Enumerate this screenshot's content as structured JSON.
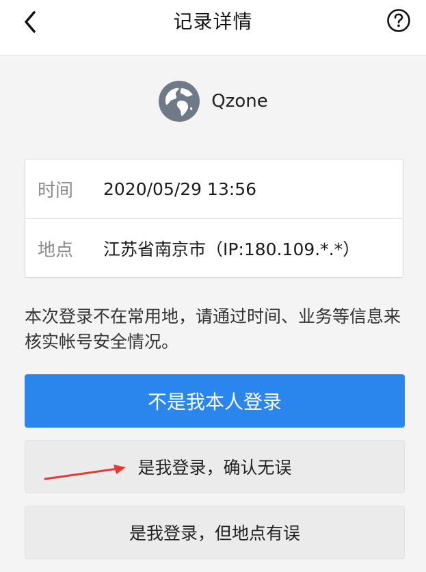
{
  "header": {
    "title": "记录详情",
    "back_icon": "chevron-left-icon",
    "help_icon": "question-circle-icon"
  },
  "app": {
    "name": "Qzone",
    "icon": "globe-icon"
  },
  "details": {
    "time_label": "时间",
    "time_value": "2020/05/29 13:56",
    "location_label": "地点",
    "location_value": "江苏省南京市（IP:180.109.*.*）"
  },
  "notice": "本次登录不在常用地，请通过时间、业务等信息来核实帐号安全情况。",
  "actions": {
    "not_me": "不是我本人登录",
    "confirm": "是我登录，确认无误",
    "wrong_location": "是我登录，但地点有误"
  },
  "colors": {
    "primary": "#2a86ec",
    "annotation_arrow": "#e53935"
  }
}
